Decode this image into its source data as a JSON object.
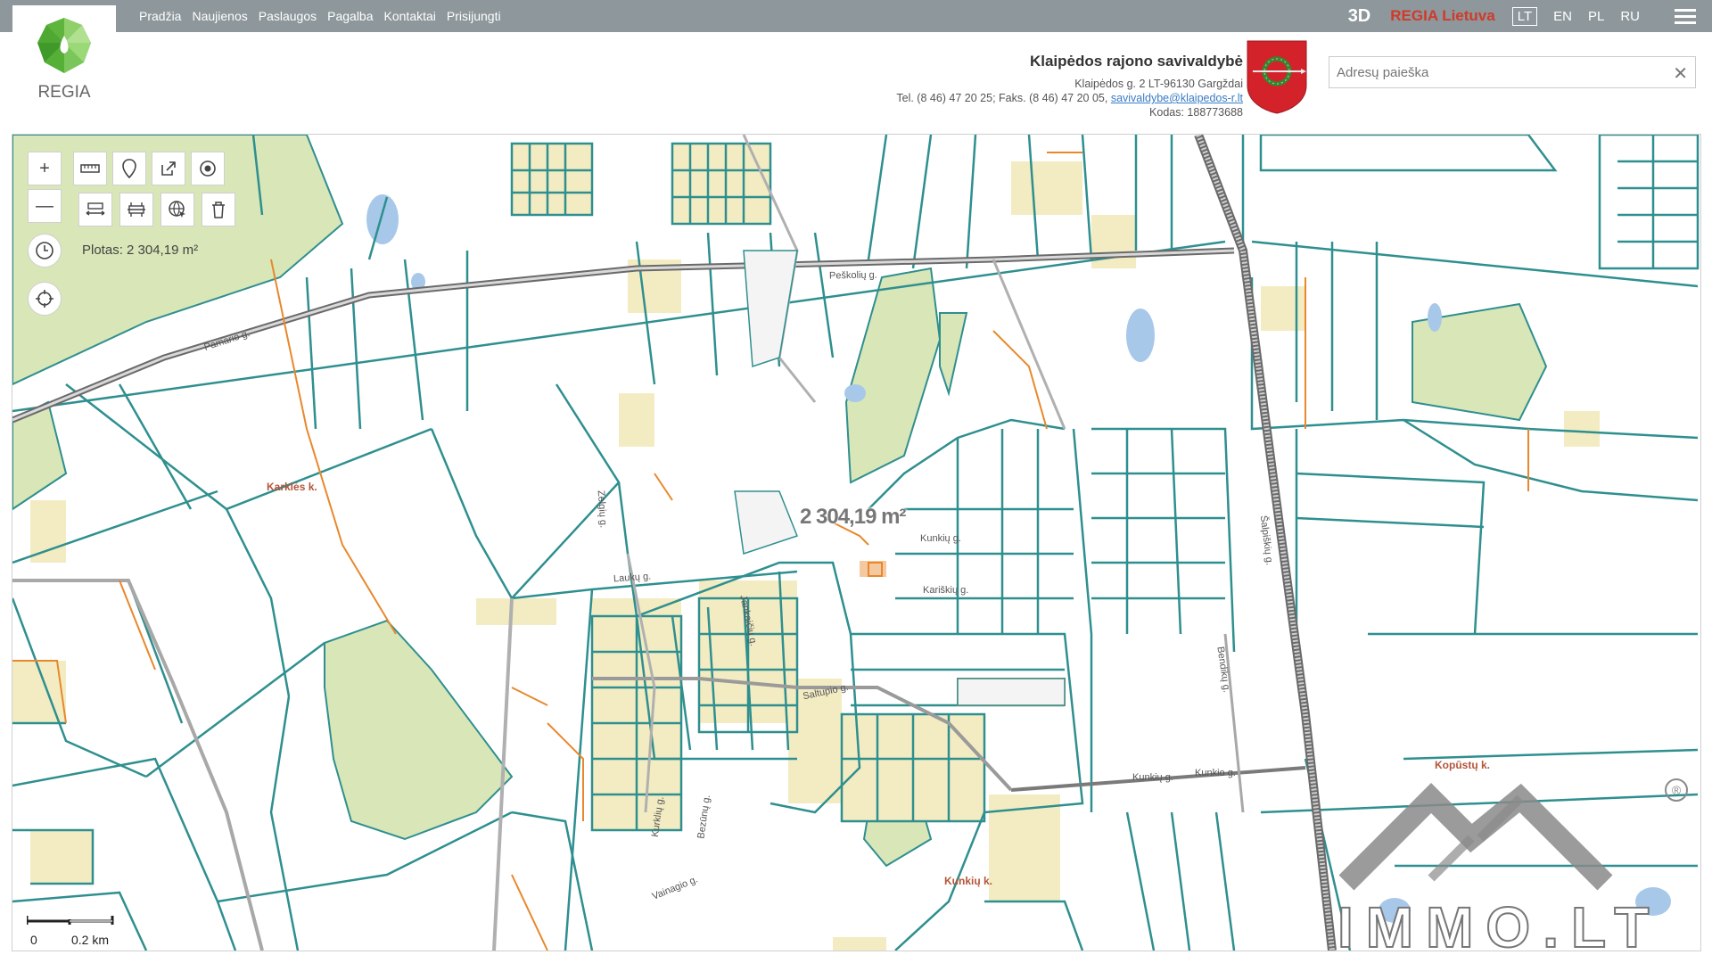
{
  "header": {
    "brand_text": "REGIA",
    "nav": [
      "Pradžia",
      "Naujienos",
      "Paslaugos",
      "Pagalba",
      "Kontaktai",
      "Prisijungti"
    ],
    "btn_3d": "3D",
    "regia_lietuva": "REGIA Lietuva",
    "languages": [
      {
        "code": "LT",
        "active": true
      },
      {
        "code": "EN",
        "active": false
      },
      {
        "code": "PL",
        "active": false
      },
      {
        "code": "RU",
        "active": false
      }
    ],
    "menu_icon": "hamburger-icon"
  },
  "municipality": {
    "name": "Klaipėdos rajono savivaldybė",
    "address": "Klaipėdos g. 2 LT-96130 Gargždai",
    "phone_prefix": "Tel. (8 46) 47 20 25; Faks. (8 46) 47 20 05,",
    "email": "savivaldybe@klaipedos-r.lt",
    "code": "Kodas: 188773688"
  },
  "search": {
    "placeholder": "Adresų paieška",
    "value": ""
  },
  "toolbar": {
    "icons": [
      "zoom-in-icon",
      "zoom-out-icon",
      "measure-distance-icon",
      "measure-area-icon",
      "share-icon",
      "point-icon",
      "pan-icon",
      "profile-icon",
      "settings-icon",
      "delete-icon",
      "history-icon",
      "locate-icon"
    ],
    "area_readout": "Plotas: 2 304,19 m²"
  },
  "map": {
    "measurement": "2 304,19 m²",
    "places": [
      "Karklės k.",
      "Kopūstų k.",
      "Kunkių k."
    ],
    "streets": [
      "Pamario g.",
      "Peškolių g.",
      "Laukų g.",
      "Zelgių g.",
      "Saltupio g.",
      "Kurklių g.",
      "Bendikų g.",
      "Kunkių g.",
      "Šalpiškių g.",
      "Kariškių g.",
      "Jankaičių g.",
      "Valčiugalio g.",
      "Kunkių g.",
      "Kunkio g.",
      "Vainagio g.",
      "Bezūnų g."
    ],
    "scale": {
      "zero": "0",
      "distance": "0.2 km"
    },
    "colors": {
      "parcel": "#2f8f8f",
      "road": "#8a8a8a",
      "forest": "#d8e6b8",
      "built": "#f3ecc2",
      "orange": "#e8882c",
      "water": "#a8c8ea"
    }
  },
  "watermark": {
    "text": "IMMO.LT",
    "registered": "®"
  }
}
